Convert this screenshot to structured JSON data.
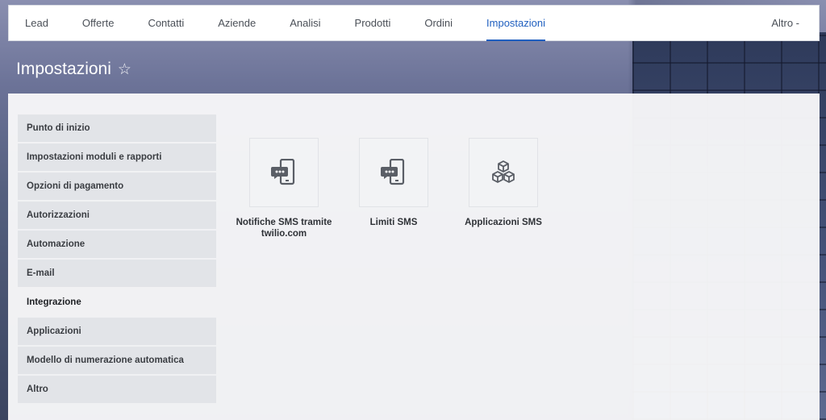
{
  "nav": {
    "items": [
      {
        "label": "Lead"
      },
      {
        "label": "Offerte"
      },
      {
        "label": "Contatti"
      },
      {
        "label": "Aziende"
      },
      {
        "label": "Analisi"
      },
      {
        "label": "Prodotti"
      },
      {
        "label": "Ordini"
      },
      {
        "label": "Impostazioni"
      }
    ],
    "active": "Impostazioni",
    "more_label": "Altro -"
  },
  "page": {
    "title": "Impostazioni",
    "favorite_icon": "star-outline-icon"
  },
  "sidebar": {
    "items": [
      {
        "label": "Punto di inizio"
      },
      {
        "label": "Impostazioni moduli e rapporti"
      },
      {
        "label": "Opzioni di pagamento"
      },
      {
        "label": "Autorizzazioni"
      },
      {
        "label": "Automazione"
      },
      {
        "label": "E-mail"
      },
      {
        "label": "Integrazione"
      },
      {
        "label": "Applicazioni"
      },
      {
        "label": "Modello di numerazione automatica"
      },
      {
        "label": "Altro"
      }
    ],
    "active": "Integrazione"
  },
  "tiles": [
    {
      "label": "Notifiche SMS tramite twilio.com",
      "icon": "sms-phone-icon"
    },
    {
      "label": "Limiti SMS",
      "icon": "sms-phone-icon"
    },
    {
      "label": "Applicazioni SMS",
      "icon": "cubes-icon"
    }
  ],
  "colors": {
    "accent": "#1f5fbf",
    "icon": "#5a5e66"
  }
}
